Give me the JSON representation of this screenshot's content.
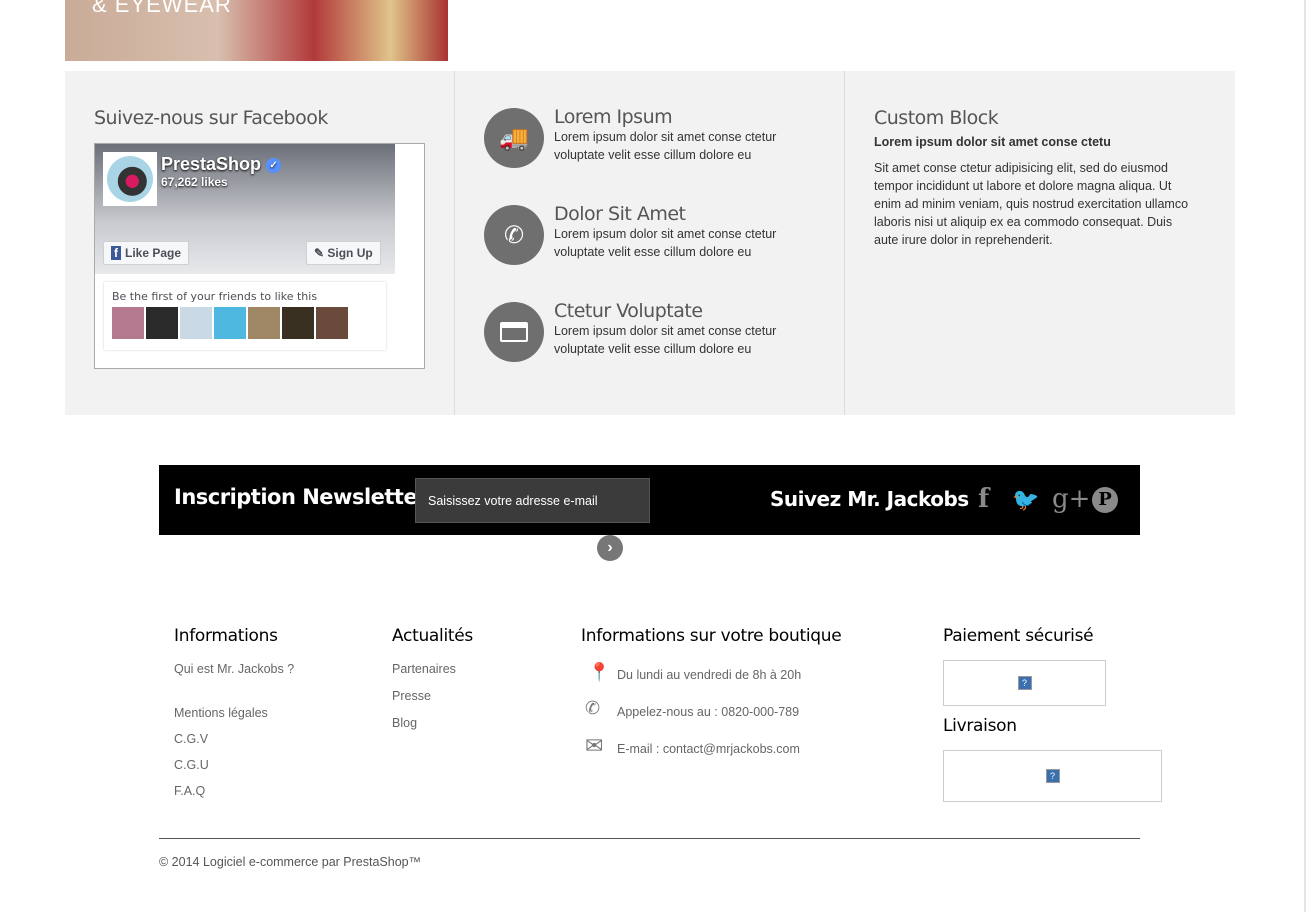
{
  "banner": {
    "text": "& EYEWEAR"
  },
  "facebook": {
    "title": "Suivez-nous sur Facebook",
    "page_name": "PrestaShop",
    "likes": "67,262 likes",
    "like_button": "Like Page",
    "signup_button": "Sign Up",
    "friends_text": "Be the first of your friends to like this"
  },
  "features": [
    {
      "icon": "truck-icon",
      "title": "Lorem Ipsum",
      "text": "Lorem ipsum dolor sit amet conse ctetur voluptate velit esse cillum dolore eu"
    },
    {
      "icon": "phone-icon",
      "title": "Dolor Sit Amet",
      "text": "Lorem ipsum dolor sit amet conse ctetur voluptate velit esse cillum dolore eu"
    },
    {
      "icon": "credit-card-icon",
      "title": "Ctetur Voluptate",
      "text": "Lorem ipsum dolor sit amet conse ctetur voluptate velit esse cillum dolore eu"
    }
  ],
  "custom_block": {
    "title": "Custom Block",
    "subtitle": "Lorem ipsum dolor sit amet conse ctetu",
    "text": "Sit amet conse ctetur adipisicing elit, sed do eiusmod tempor incididunt ut labore et dolore magna aliqua. Ut enim ad minim veniam, quis nostrud exercitation ullamco laboris nisi ut aliquip ex ea commodo consequat. Duis aute irure dolor in reprehenderit."
  },
  "newsletter": {
    "title": "Inscription Newsletter",
    "placeholder": "Saisissez votre adresse e-mail",
    "submit": "›",
    "follow": "Suivez Mr. Jackobs",
    "social": {
      "facebook": "f",
      "twitter": "🐦",
      "google": "g+",
      "pinterest": "℗"
    }
  },
  "footer": {
    "informations": {
      "title": "Informations",
      "links": [
        "Qui est Mr. Jackobs ?",
        "Mentions légales",
        "C.G.V",
        "C.G.U",
        "F.A.Q"
      ]
    },
    "actualites": {
      "title": "Actualités",
      "links": [
        "Partenaires",
        "Presse",
        "Blog"
      ]
    },
    "store": {
      "title": "Informations sur votre boutique",
      "hours": "Du lundi au vendredi de 8h à 20h",
      "phone": "Appelez-nous au : 0820-000-789",
      "email": "E-mail : contact@mrjackobs.com"
    },
    "payment": {
      "title": "Paiement sécurisé"
    },
    "delivery": {
      "title": "Livraison"
    },
    "copyright": "© 2014 Logiciel e-commerce par PrestaShop™"
  }
}
